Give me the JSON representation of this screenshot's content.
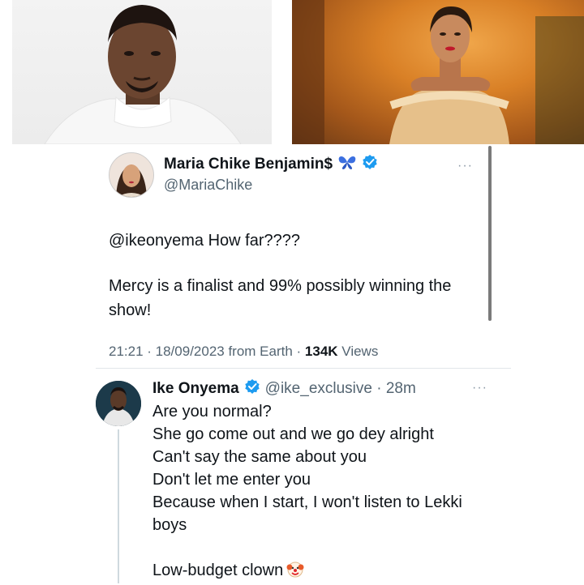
{
  "tweet": {
    "display_name": "Maria Chike Benjamin$",
    "handle": "@MariaChike",
    "line1": "@ikeonyema How far????",
    "line2": "Mercy is a finalist and 99% possibly winning the show!",
    "timestamp": "21:21 · 18/09/2023 from Earth · ",
    "views_count": "134K",
    "views_label": " Views",
    "more": "···"
  },
  "reply": {
    "display_name": "Ike Onyema",
    "handle_time": "@ike_exclusive · 28m",
    "more": "···",
    "lines": [
      "Are you normal?",
      "She go come out and we go dey alright",
      "Can't say the same about you",
      "Don't let me enter you",
      "Because when I start, I won't listen to Lekki boys"
    ],
    "closing": "Low-budget clown"
  },
  "colors": {
    "verified_blue": "#1d9bf0",
    "butterfly_blue": "#3b6fe0",
    "secondary_text": "#536471"
  },
  "icons": {
    "verified": "verified-badge-icon",
    "butterfly": "butterfly-emoji-icon",
    "clown": "clown-emoji-icon"
  }
}
